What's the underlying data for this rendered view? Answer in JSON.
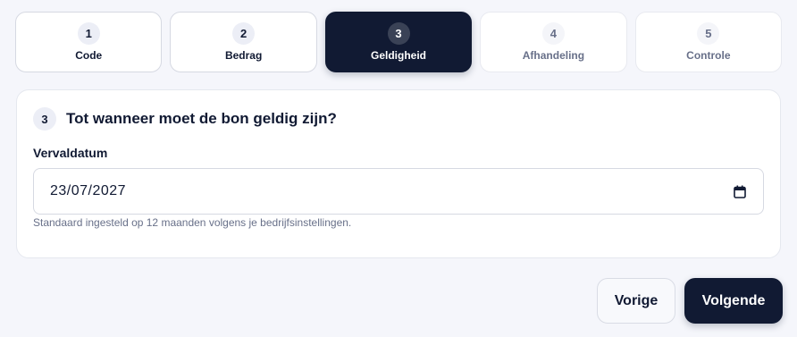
{
  "stepper": {
    "steps": [
      {
        "number": "1",
        "label": "Code",
        "state": "completed"
      },
      {
        "number": "2",
        "label": "Bedrag",
        "state": "completed"
      },
      {
        "number": "3",
        "label": "Geldigheid",
        "state": "active"
      },
      {
        "number": "4",
        "label": "Afhandeling",
        "state": "upcoming"
      },
      {
        "number": "5",
        "label": "Controle",
        "state": "upcoming"
      }
    ]
  },
  "card": {
    "number": "3",
    "title": "Tot wanneer moet de bon geldig zijn?",
    "field_label": "Vervaldatum",
    "date_value": "23/07/2027",
    "calendar_icon": "calendar-icon",
    "helper_text": "Standaard ingesteld op 12 maanden volgens je bedrijfsinstellingen."
  },
  "actions": {
    "prev_label": "Vorige",
    "next_label": "Volgende"
  },
  "colors": {
    "primary": "#111a33",
    "background": "#f5f6fb",
    "muted_text": "#687089"
  }
}
